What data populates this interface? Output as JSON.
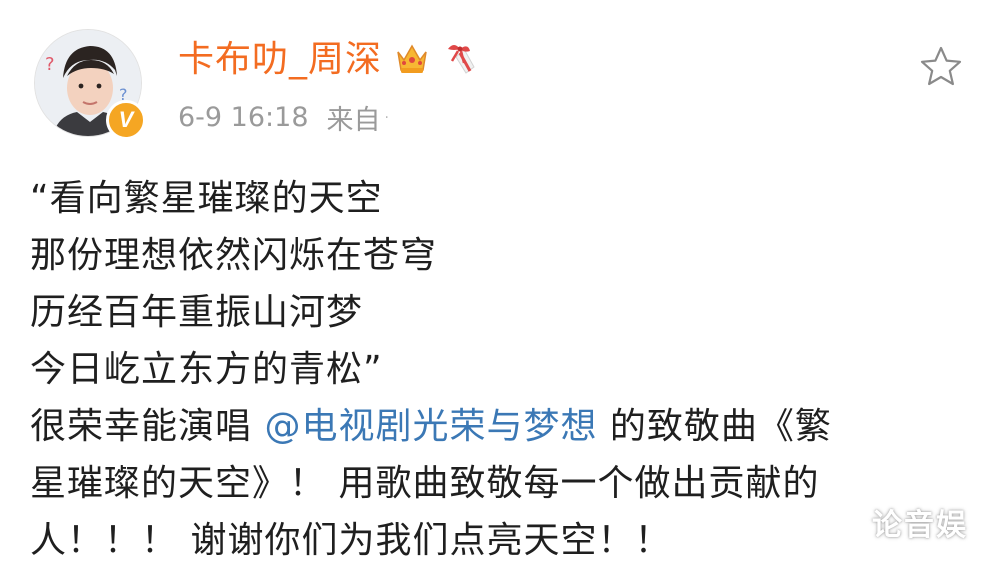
{
  "author": {
    "name": "卡布叻_周深",
    "badges": [
      "crown-icon",
      "gift-icon"
    ],
    "verified_mark": "V"
  },
  "meta": {
    "time": "6-9 16:18",
    "source_prefix": "来自",
    "dot": "·"
  },
  "actions": {
    "favorite_icon": "star-icon"
  },
  "content": {
    "quote_lines": [
      "“看向繁星璀璨的天空",
      "那份理想依然闪烁在苍穹",
      "历经百年重振山河梦",
      "今日屹立东方的青松”"
    ],
    "text_before_mention": "很荣幸能演唱 ",
    "mention": "@电视剧光荣与梦想",
    "text_after_mention": " 的致敬曲《繁",
    "line_6": "星璀璨的天空》！ 用歌曲致敬每一个做出贡献的",
    "line_7": "人！！！ 谢谢你们为我们点亮天空！！"
  },
  "watermark": "论音娱",
  "colors": {
    "username": "#f36c21",
    "mention": "#3b78b5",
    "meta": "#9a9a9a",
    "verified": "#f5a623"
  }
}
